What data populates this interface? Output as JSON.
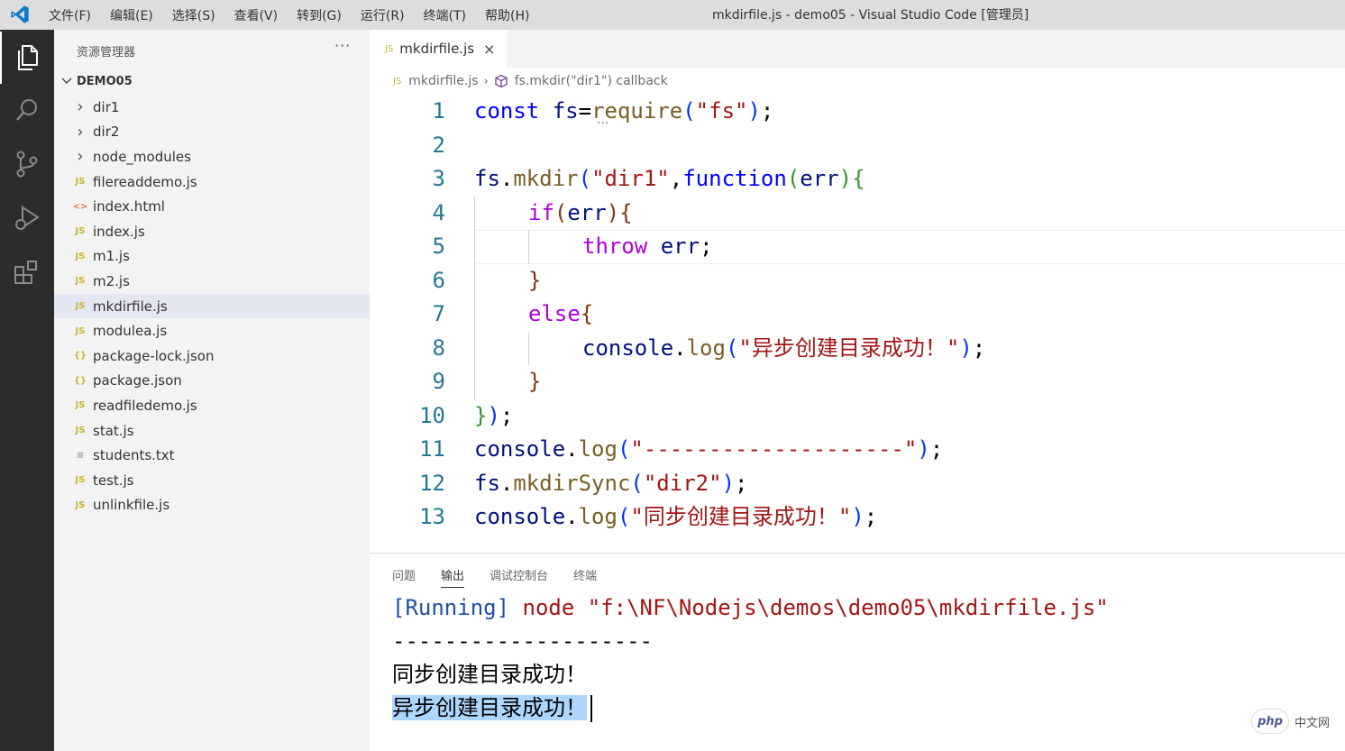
{
  "menu": [
    "文件(F)",
    "编辑(E)",
    "选择(S)",
    "查看(V)",
    "转到(G)",
    "运行(R)",
    "终端(T)",
    "帮助(H)"
  ],
  "window_title": "mkdirfile.js - demo05 - Visual Studio Code [管理员]",
  "sidebar": {
    "title": "资源管理器",
    "more": "···",
    "project": "DEMO05",
    "items": [
      {
        "type": "folder",
        "icon": "chevron-right-icon",
        "glyph": "›",
        "label": "dir1"
      },
      {
        "type": "folder",
        "icon": "chevron-right-icon",
        "glyph": "›",
        "label": "dir2"
      },
      {
        "type": "folder",
        "icon": "chevron-right-icon",
        "glyph": "›",
        "label": "node_modules"
      },
      {
        "type": "js",
        "icon": "js-file-icon",
        "glyph": "JS",
        "label": "filereaddemo.js"
      },
      {
        "type": "html",
        "icon": "html-file-icon",
        "glyph": "<>",
        "label": "index.html"
      },
      {
        "type": "js",
        "icon": "js-file-icon",
        "glyph": "JS",
        "label": "index.js"
      },
      {
        "type": "js",
        "icon": "js-file-icon",
        "glyph": "JS",
        "label": "m1.js"
      },
      {
        "type": "js",
        "icon": "js-file-icon",
        "glyph": "JS",
        "label": "m2.js"
      },
      {
        "type": "js",
        "icon": "js-file-icon",
        "glyph": "JS",
        "label": "mkdirfile.js",
        "selected": true
      },
      {
        "type": "js",
        "icon": "js-file-icon",
        "glyph": "JS",
        "label": "modulea.js"
      },
      {
        "type": "json",
        "icon": "json-file-icon",
        "glyph": "{}",
        "label": "package-lock.json"
      },
      {
        "type": "json",
        "icon": "json-file-icon",
        "glyph": "{}",
        "label": "package.json"
      },
      {
        "type": "js",
        "icon": "js-file-icon",
        "glyph": "JS",
        "label": "readfiledemo.js"
      },
      {
        "type": "js",
        "icon": "js-file-icon",
        "glyph": "JS",
        "label": "stat.js"
      },
      {
        "type": "txt",
        "icon": "text-file-icon",
        "glyph": "≡",
        "label": "students.txt"
      },
      {
        "type": "js",
        "icon": "js-file-icon",
        "glyph": "JS",
        "label": "test.js"
      },
      {
        "type": "js",
        "icon": "js-file-icon",
        "glyph": "JS",
        "label": "unlinkfile.js"
      }
    ]
  },
  "tab": {
    "icon": "JS",
    "label": "mkdirfile.js",
    "close": "×"
  },
  "breadcrumb": {
    "icon": "JS",
    "file": "mkdirfile.js",
    "sep": "›",
    "symbol": "fs.mkdir(\"dir1\") callback"
  },
  "code_lines": [
    {
      "n": "1",
      "indent": 0,
      "tokens": [
        [
          "k",
          "const"
        ],
        [
          "",
          ""
        ],
        [
          "v",
          " fs"
        ],
        [
          "",
          "="
        ],
        [
          "f",
          "require"
        ],
        [
          "p1",
          "("
        ],
        [
          "s",
          "\"fs\""
        ],
        [
          "p1",
          ")"
        ],
        [
          "",
          ";"
        ]
      ]
    },
    {
      "n": "2",
      "indent": 0,
      "tokens": []
    },
    {
      "n": "3",
      "indent": 0,
      "tokens": [
        [
          "v",
          "fs"
        ],
        [
          "",
          "."
        ],
        [
          "f",
          "mkdir"
        ],
        [
          "p1",
          "("
        ],
        [
          "s",
          "\"dir1\""
        ],
        [
          "",
          ","
        ],
        [
          "k",
          "function"
        ],
        [
          "p2",
          "("
        ],
        [
          "v",
          "err"
        ],
        [
          "p2",
          ")"
        ],
        [
          "p2",
          "{"
        ]
      ]
    },
    {
      "n": "4",
      "indent": 1,
      "tokens": [
        [
          "kw",
          "if"
        ],
        [
          "p3",
          "("
        ],
        [
          "v",
          "err"
        ],
        [
          "p3",
          ")"
        ],
        [
          "p3",
          "{"
        ]
      ]
    },
    {
      "n": "5",
      "indent": 2,
      "tokens": [
        [
          "kw",
          "throw"
        ],
        [
          "",
          " "
        ],
        [
          "v",
          "err"
        ],
        [
          "",
          ";"
        ]
      ]
    },
    {
      "n": "6",
      "indent": 1,
      "tokens": [
        [
          "p3",
          "}"
        ]
      ]
    },
    {
      "n": "7",
      "indent": 1,
      "tokens": [
        [
          "kw",
          "else"
        ],
        [
          "p3",
          "{"
        ]
      ]
    },
    {
      "n": "8",
      "indent": 2,
      "tokens": [
        [
          "v",
          "console"
        ],
        [
          "",
          "."
        ],
        [
          "f",
          "log"
        ],
        [
          "p1",
          "("
        ],
        [
          "s",
          "\"异步创建目录成功！\""
        ],
        [
          "p1",
          ")"
        ],
        [
          "",
          ";"
        ]
      ]
    },
    {
      "n": "9",
      "indent": 1,
      "tokens": [
        [
          "p3",
          "}"
        ]
      ]
    },
    {
      "n": "10",
      "indent": 0,
      "tokens": [
        [
          "p2",
          "}"
        ],
        [
          "p1",
          ")"
        ],
        [
          "",
          ";"
        ]
      ]
    },
    {
      "n": "11",
      "indent": 0,
      "tokens": [
        [
          "v",
          "console"
        ],
        [
          "",
          "."
        ],
        [
          "f",
          "log"
        ],
        [
          "p1",
          "("
        ],
        [
          "s",
          "\"--------------------\""
        ],
        [
          "p1",
          ")"
        ],
        [
          "",
          ";"
        ]
      ]
    },
    {
      "n": "12",
      "indent": 0,
      "tokens": [
        [
          "v",
          "fs"
        ],
        [
          "",
          "."
        ],
        [
          "f",
          "mkdirSync"
        ],
        [
          "p1",
          "("
        ],
        [
          "s",
          "\"dir2\""
        ],
        [
          "p1",
          ")"
        ],
        [
          "",
          ";"
        ]
      ]
    },
    {
      "n": "13",
      "indent": 0,
      "tokens": [
        [
          "v",
          "console"
        ],
        [
          "",
          "."
        ],
        [
          "f",
          "log"
        ],
        [
          "p1",
          "("
        ],
        [
          "s",
          "\"同步创建目录成功！\""
        ],
        [
          "p1",
          ")"
        ],
        [
          "",
          ";"
        ]
      ]
    }
  ],
  "panel": {
    "tabs": [
      "问题",
      "输出",
      "调试控制台",
      "终端"
    ],
    "active_tab": "输出",
    "output": {
      "running_tag": "[Running]",
      "command": " node \"f:\\NF\\Nodejs\\demos\\demo05\\mkdirfile.js\"",
      "line2": "--------------------",
      "line3": "同步创建目录成功！",
      "line4": "异步创建目录成功！"
    }
  },
  "watermark": {
    "logo": "php",
    "text": "中文网"
  },
  "colors": {
    "activitybar": "#2c2c2c",
    "sidebar": "#f3f3f3",
    "selection": "#add6ff",
    "accent": "#007acc"
  }
}
